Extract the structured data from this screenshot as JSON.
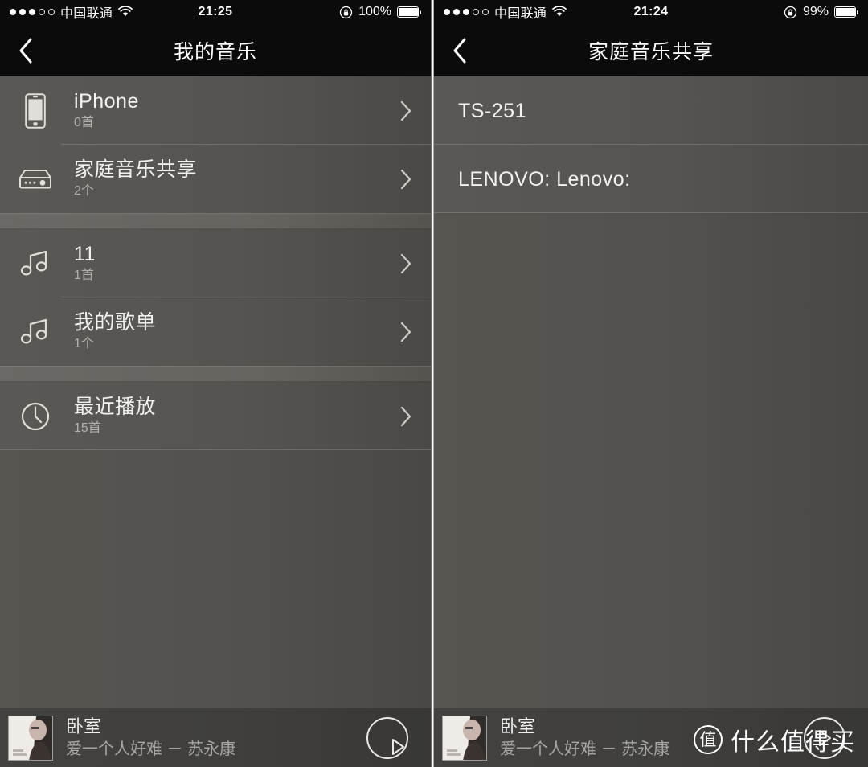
{
  "left": {
    "status": {
      "carrier": "中国联通",
      "time": "21:25",
      "battery_pct": "100%",
      "signal_filled": 3,
      "signal_total": 5,
      "wifi_icon": "wifi-icon",
      "lock_icon": "rotation-lock-icon"
    },
    "nav": {
      "back_icon": "chevron-left-icon",
      "title": "我的音乐"
    },
    "sections": [
      {
        "rows": [
          {
            "icon": "iphone-icon",
            "title": "iPhone",
            "subtitle": "0首",
            "chevron": "chevron-right-icon"
          },
          {
            "icon": "nas-server-icon",
            "title": "家庭音乐共享",
            "subtitle": "2个",
            "chevron": "chevron-right-icon"
          }
        ]
      },
      {
        "rows": [
          {
            "icon": "music-note-icon",
            "title": "11",
            "subtitle": "1首",
            "chevron": "chevron-right-icon"
          },
          {
            "icon": "music-note-icon",
            "title": "我的歌单",
            "subtitle": "1个",
            "chevron": "chevron-right-icon"
          }
        ]
      },
      {
        "rows": [
          {
            "icon": "clock-icon",
            "title": "最近播放",
            "subtitle": "15首",
            "chevron": "chevron-right-icon"
          }
        ]
      }
    ],
    "nowplaying": {
      "artwork": "album-artwork",
      "title": "卧室",
      "subtitle": "爱一个人好难 － 苏永康",
      "play_icon": "play-button-icon"
    }
  },
  "right": {
    "status": {
      "carrier": "中国联通",
      "time": "21:24",
      "battery_pct": "99%",
      "signal_filled": 3,
      "signal_total": 5,
      "wifi_icon": "wifi-icon",
      "lock_icon": "rotation-lock-icon"
    },
    "nav": {
      "back_icon": "chevron-left-icon",
      "title": "家庭音乐共享"
    },
    "rows": [
      {
        "title": "TS-251"
      },
      {
        "title": "LENOVO: Lenovo:"
      }
    ],
    "nowplaying": {
      "artwork": "album-artwork",
      "title": "卧室",
      "subtitle": "爱一个人好难 － 苏永康",
      "play_icon": "play-button-icon"
    },
    "watermark": {
      "logo_char": "值",
      "text": "什么值得买"
    }
  },
  "colors": {
    "bar_bg": "#0b0b0b",
    "list_bg": "#55534f",
    "divider": "#6b6965",
    "title_text": "#f2f2f2",
    "sub_text": "#b3b1ad",
    "nowplaying_bg": "#413f3d"
  }
}
